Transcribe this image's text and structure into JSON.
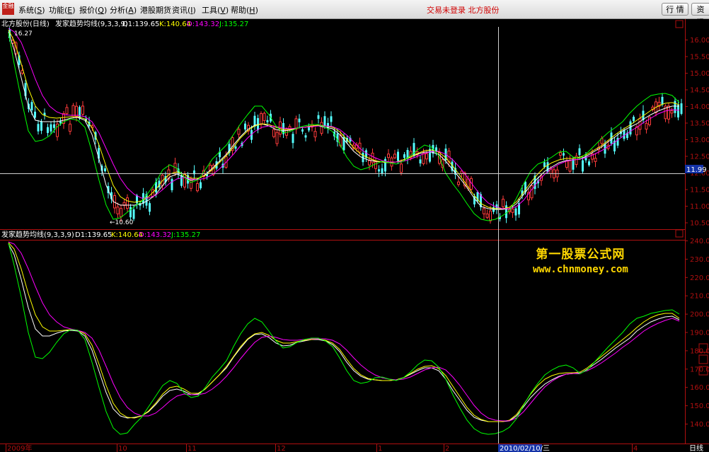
{
  "menubar": {
    "logo_text": "金融",
    "items": [
      {
        "name": "menu-system",
        "label": "系统",
        "key": "S"
      },
      {
        "name": "menu-function",
        "label": "功能",
        "key": "E"
      },
      {
        "name": "menu-quote",
        "label": "报价",
        "key": "Q"
      },
      {
        "name": "menu-analysis",
        "label": "分析",
        "key": "A"
      },
      {
        "name": "menu-hk-futures",
        "label": "港股期货",
        "key": ""
      },
      {
        "name": "menu-info",
        "label": "资讯",
        "key": "I"
      },
      {
        "name": "menu-tools",
        "label": "工具",
        "key": "V"
      },
      {
        "name": "menu-help",
        "label": "帮助",
        "key": "H"
      }
    ],
    "status_text": "交易未登录  北方股份",
    "btn_quote": "行 情",
    "btn_info": "资 讯"
  },
  "main_panel": {
    "stock_title": "北方股份(日线)",
    "indicator_label": "发家趋势均线(9,3,3,9)",
    "d1": "D1:139.65",
    "k": "K:140.64",
    "d": "D:143.32",
    "j": "J:135.27",
    "high_marker": "16.27",
    "low_marker": "←10.60",
    "current_price": "11.99",
    "y_ticks": [
      "16.00",
      "15.50",
      "15.00",
      "14.50",
      "14.00",
      "13.50",
      "13.00",
      "12.50",
      "12.00",
      "11.50",
      "11.00",
      "10.50"
    ]
  },
  "sub_panel": {
    "indicator_label": "发家趋势均线(9,3,3,9)",
    "d1": "D1:139.65",
    "k": "K:140.64",
    "d": "D:143.32",
    "j": "J:135.27",
    "y_ticks": [
      "240.00",
      "230.00",
      "220.00",
      "210.00",
      "200.00",
      "190.00",
      "180.00",
      "170.00",
      "160.00",
      "150.00",
      "140.00"
    ]
  },
  "x_axis": {
    "labels": [
      "2009年",
      "10",
      "11",
      "12",
      "1",
      "2",
      "4"
    ],
    "cursor_date": "2010/02/10/三",
    "period_label": "日线"
  },
  "watermark": {
    "line1": "第一股票公式网",
    "line2": "www.chnmoney.com"
  },
  "colors": {
    "background": "#000000",
    "axis_red": "#b01010",
    "candle_up": "#ff3b3b",
    "candle_down": "#54fcfc",
    "line_white": "#ffffff",
    "line_yellow": "#ffff00",
    "line_magenta": "#ff00ff",
    "line_green": "#00ff00",
    "watermark": "#ffd700"
  },
  "chart_data": {
    "type": "candlestick",
    "x": [
      "2009年",
      "10",
      "11",
      "12",
      "1",
      "2",
      "4"
    ],
    "series": [
      {
        "name": "price",
        "ylim": [
          10.3,
          16.4
        ],
        "high": 16.27,
        "low": 10.6,
        "last": 11.99
      },
      {
        "name": "D1",
        "ylim": [
          135,
          242
        ],
        "value": 139.65
      },
      {
        "name": "K",
        "value": 140.64
      },
      {
        "name": "D",
        "value": 143.32
      },
      {
        "name": "J",
        "value": 135.27
      }
    ]
  }
}
